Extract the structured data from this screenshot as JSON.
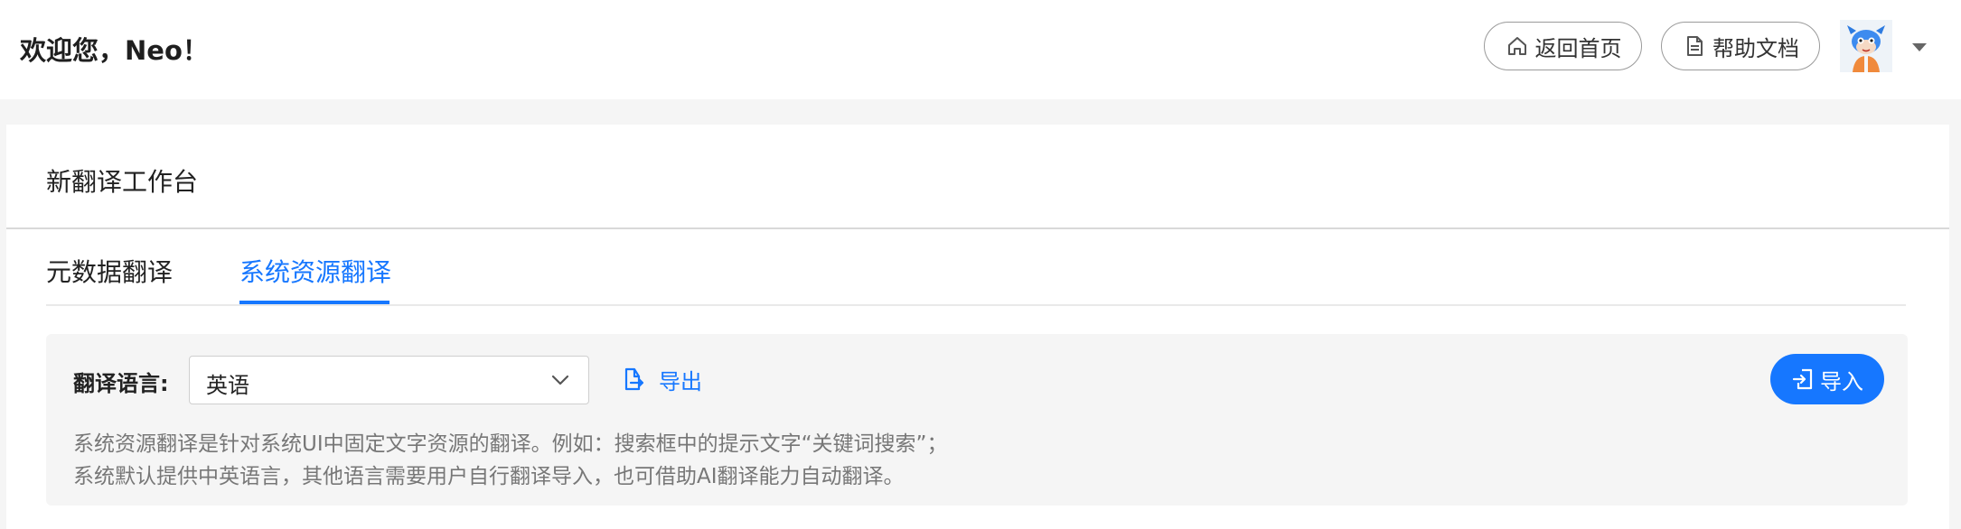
{
  "header": {
    "welcome": "欢迎您，Neo！",
    "home_label": "返回首页",
    "docs_label": "帮助文档"
  },
  "card": {
    "title": "新翻译工作台",
    "tabs": [
      {
        "label": "元数据翻译",
        "active": false
      },
      {
        "label": "系统资源翻译",
        "active": true
      }
    ]
  },
  "panel": {
    "language_label": "翻译语言:",
    "language_value": "英语",
    "export_label": "导出",
    "import_label": "导入",
    "description": [
      "系统资源翻译是针对系统UI中固定文字资源的翻译。例如：搜索框中的提示文字“关键词搜索”；",
      "系统默认提供中英语言，其他语言需要用户自行翻译导入，也可借助AI翻译能力自动翻译。"
    ]
  },
  "colors": {
    "accent": "#1677ff",
    "page_background": "#f5f5f5",
    "panel_background": "#f5f5f5"
  },
  "icons": {
    "home": "home-icon",
    "docs": "document-icon",
    "export": "export-file-icon",
    "import": "import-file-icon",
    "dropdown": "caret-down-icon"
  }
}
